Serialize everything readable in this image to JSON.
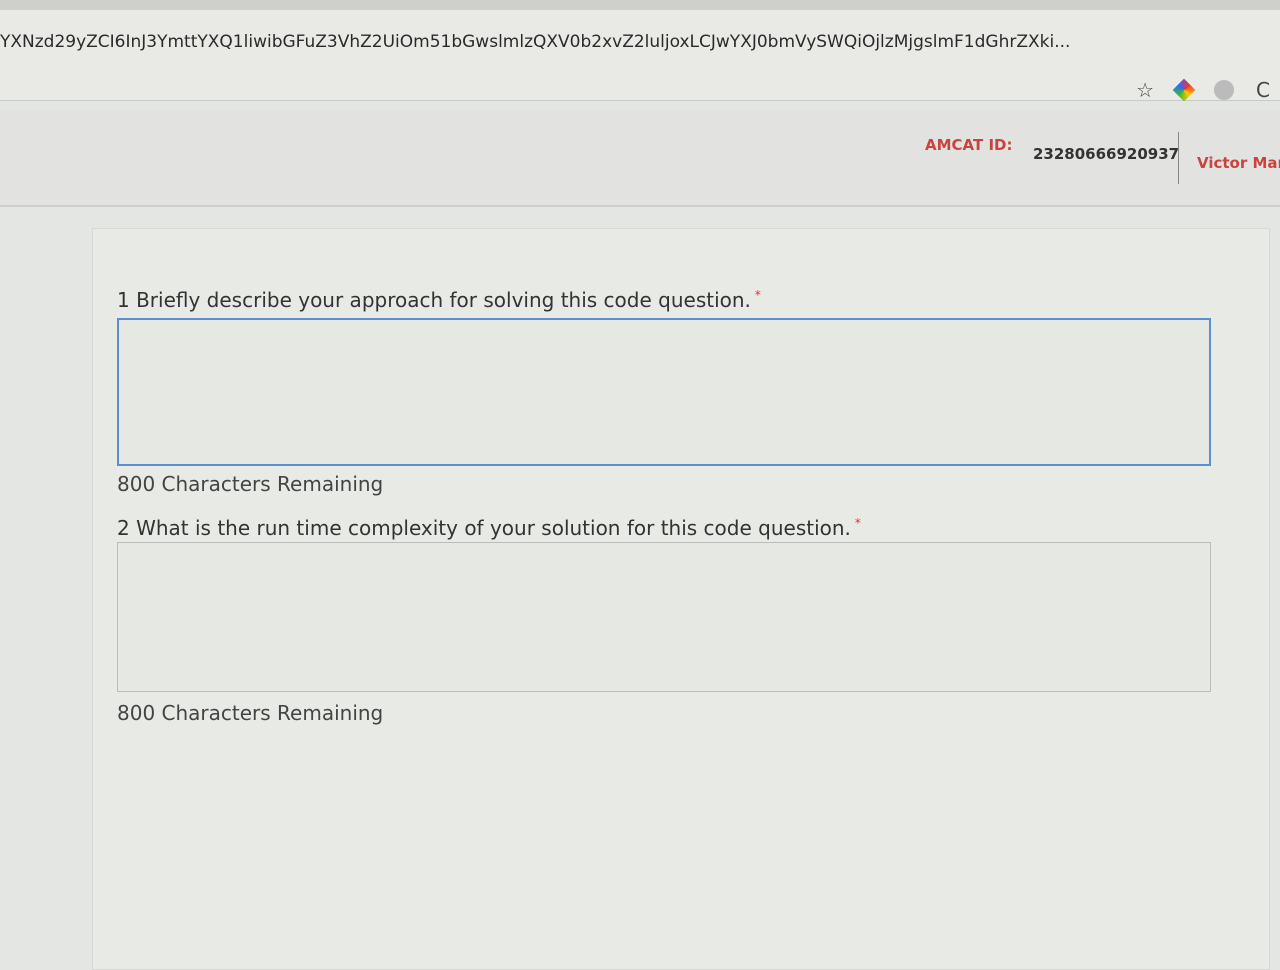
{
  "browser": {
    "url": "YXNzd29yZCI6InJ3YmttYXQ1liwibGFuZ3VhZ2UiOm51bGwslmlzQXV0b2xvZ2luljoxLCJwYXJ0bmVySWQiOjlzMjgslmF1dGhrZXki...",
    "icons": [
      "star-icon",
      "extension-icon",
      "camera-icon",
      "profile-icon"
    ]
  },
  "header": {
    "amcat_label": "AMCAT ID:",
    "amcat_id": "23280666920937",
    "user_name": "Victor Mart"
  },
  "questions": [
    {
      "label": "1 Briefly describe your approach for solving this code question.",
      "required": "*",
      "value": "",
      "remaining": "800 Characters Remaining"
    },
    {
      "label": "2 What is the run time complexity of your solution for this code question.",
      "required": "*",
      "value": "",
      "remaining": "800 Characters Remaining"
    }
  ],
  "colors": {
    "accent": "#c9433f",
    "focus": "#5a8fd0"
  }
}
